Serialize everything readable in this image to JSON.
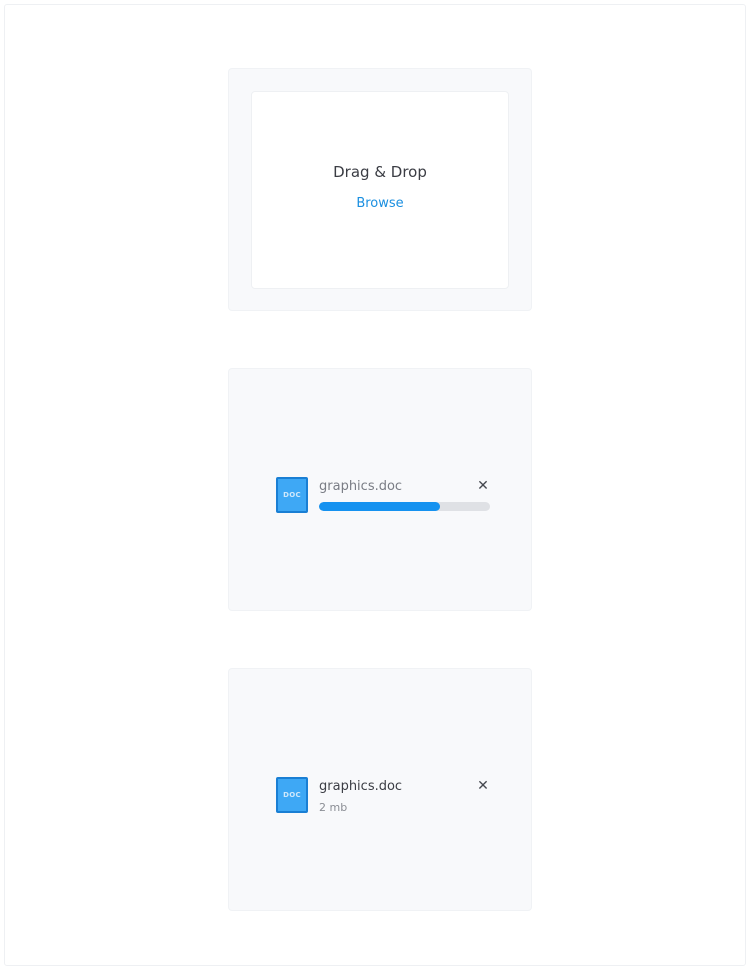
{
  "dropzone": {
    "title": "Drag & Drop",
    "browse_label": "Browse"
  },
  "uploading": {
    "file_icon_label": "DOC",
    "file_name": "graphics.doc",
    "close_symbol": "✕",
    "progress": 0.71
  },
  "uploaded": {
    "file_icon_label": "DOC",
    "file_name": "graphics.doc",
    "file_size": "2 mb",
    "close_symbol": "✕"
  },
  "colors": {
    "accent": "#1592f0",
    "link": "#1a8fe0",
    "doc_icon": "#3ea8f5"
  }
}
